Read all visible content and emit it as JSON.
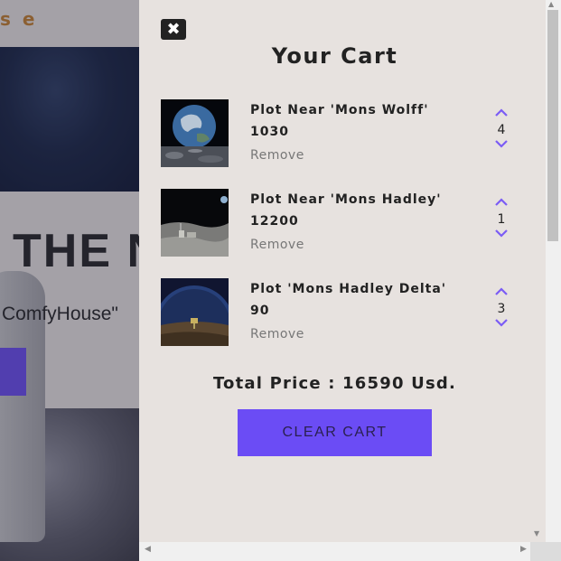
{
  "background_page": {
    "logo": "s e",
    "hero_title": "THE N",
    "hero_subtitle": "ComfyHouse\""
  },
  "cart": {
    "close_icon": "close-x-icon",
    "title": "Your Cart",
    "items": [
      {
        "name": "Plot Near 'Mons Wolff'",
        "price": "1030",
        "remove_label": "Remove",
        "quantity": "4",
        "image": "earth-rise-over-moon"
      },
      {
        "name": "Plot Near 'Mons Hadley'",
        "price": "12200",
        "remove_label": "Remove",
        "quantity": "1",
        "image": "moon-base-surface"
      },
      {
        "name": "Plot 'Mons Hadley Delta'",
        "price": "90",
        "remove_label": "Remove",
        "quantity": "3",
        "image": "planet-over-moon-rover"
      }
    ],
    "total_label": "Total Price : 16590 Usd.",
    "clear_button": "CLEAR CART"
  },
  "colors": {
    "accent": "#6b4cf5",
    "panel_bg": "#e7e2df",
    "chevron": "#7b5cf5"
  }
}
